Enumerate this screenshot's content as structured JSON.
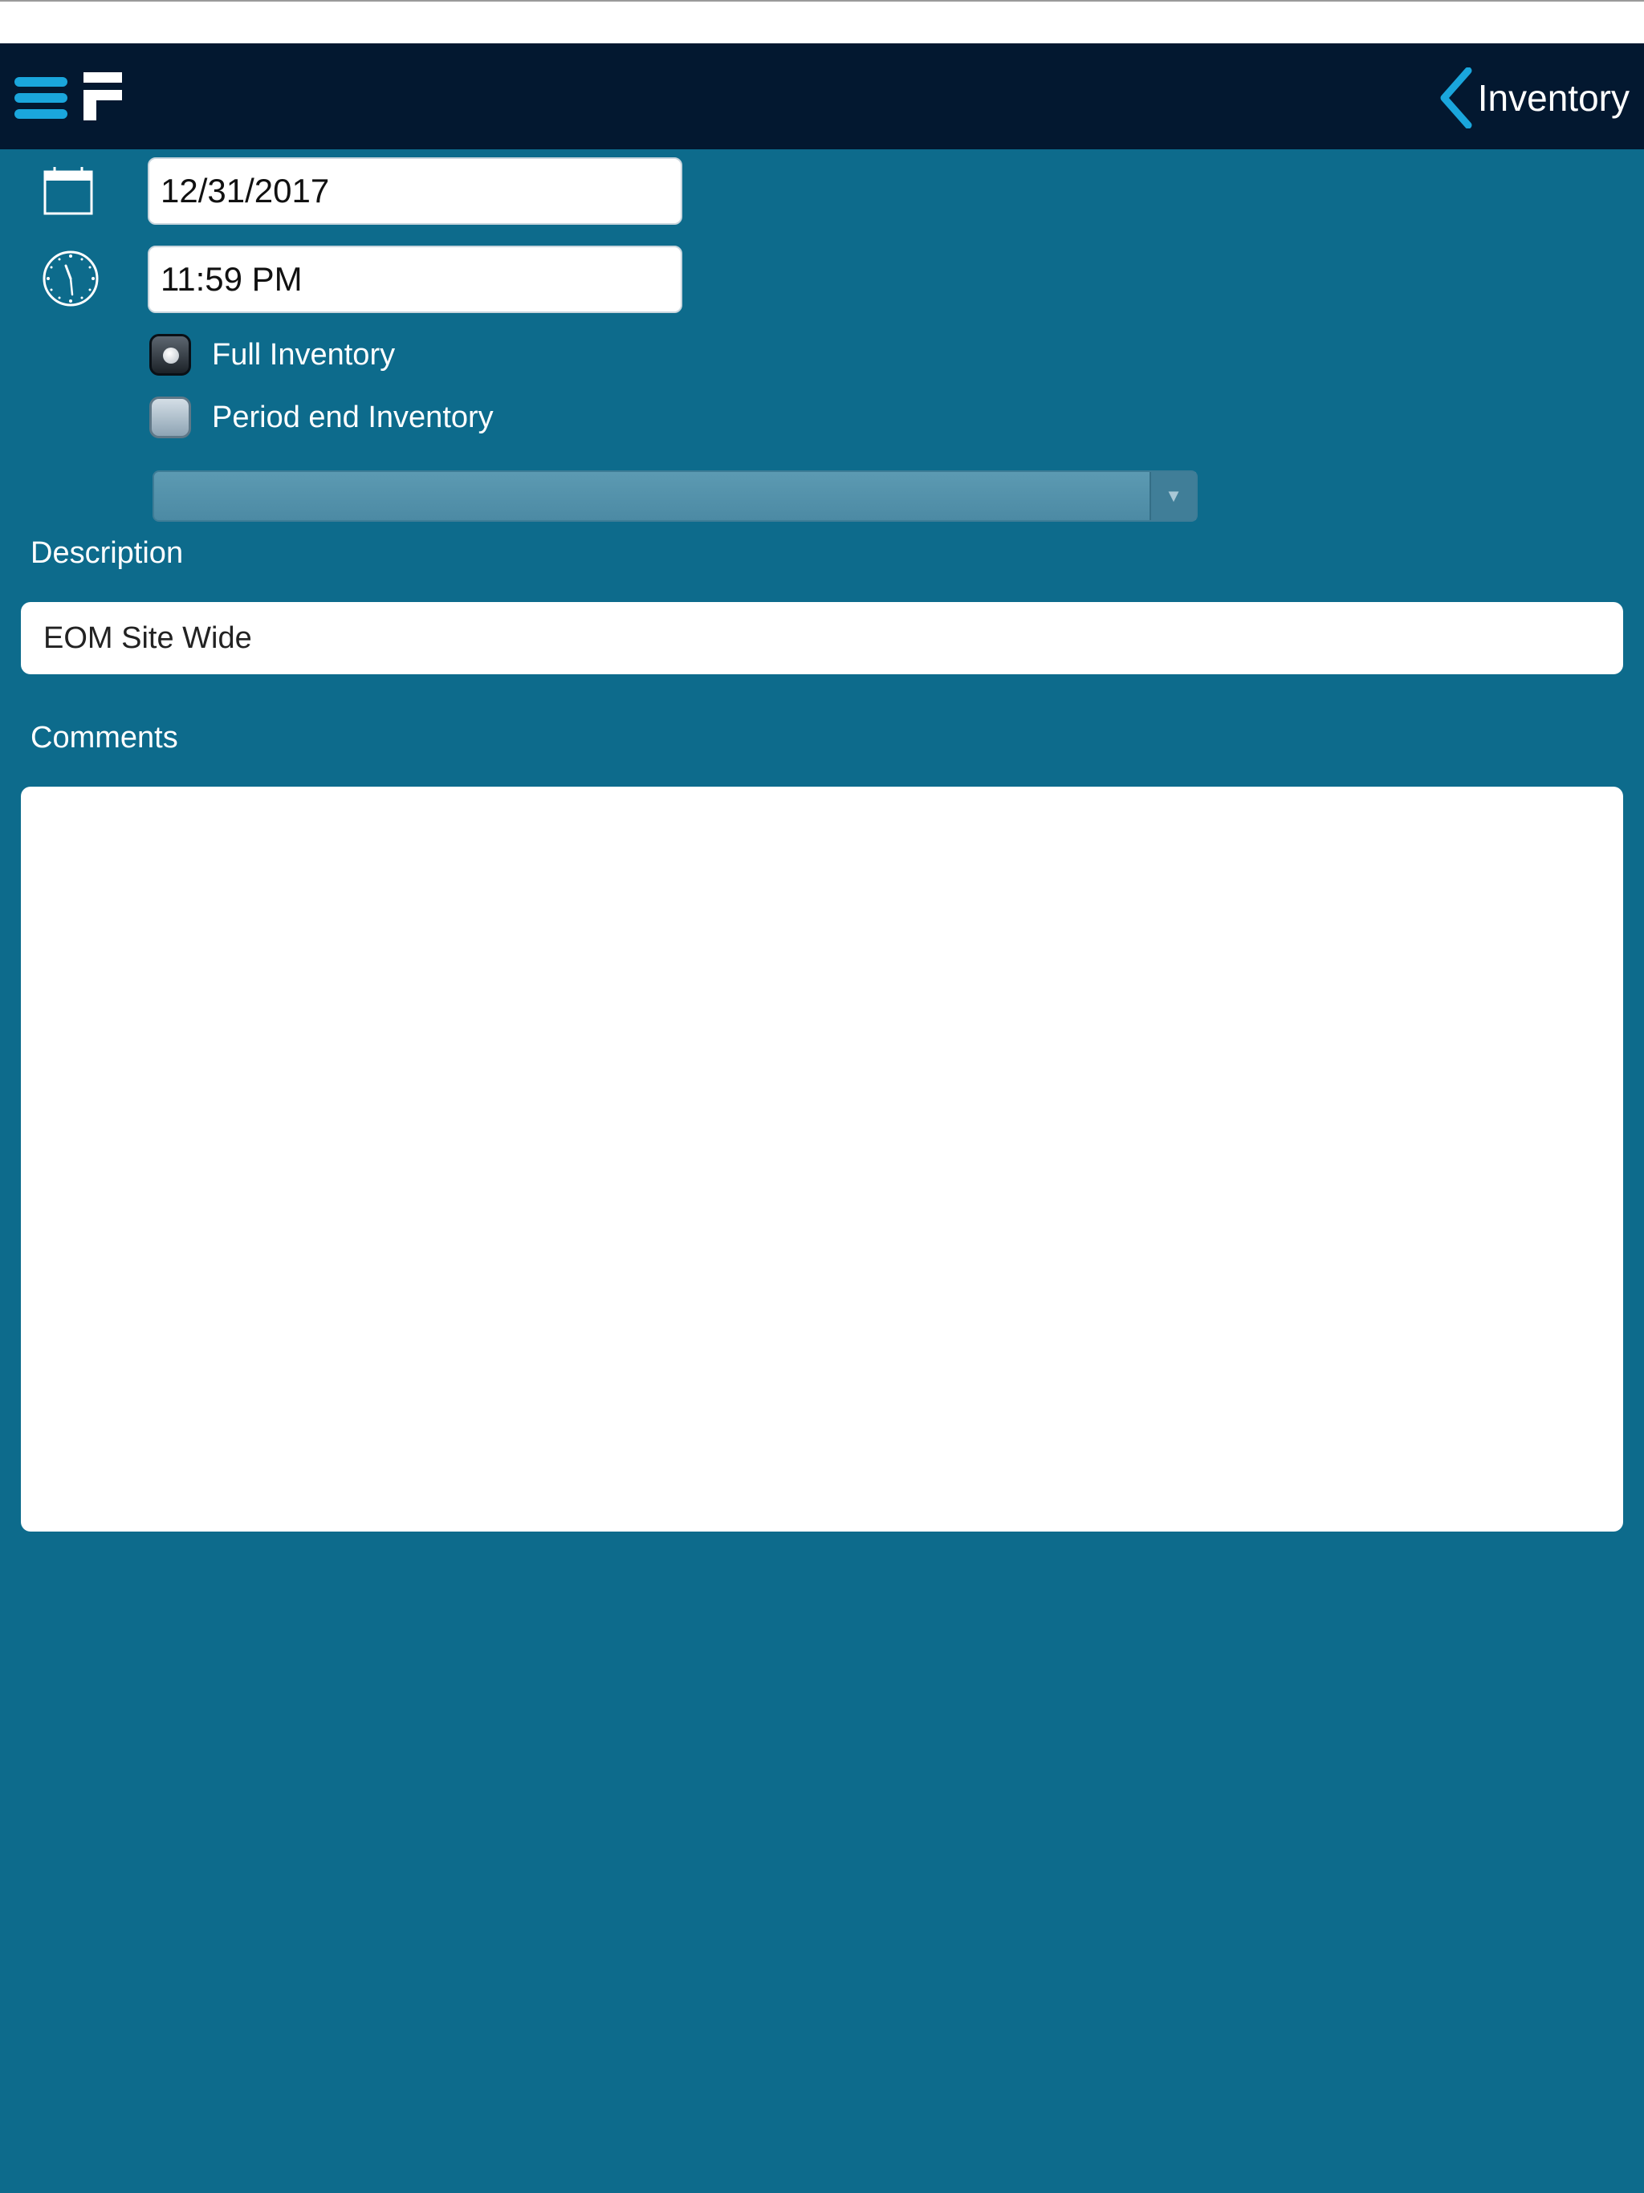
{
  "header": {
    "back_label": "Inventory"
  },
  "icons": {
    "menu": "hamburger-menu-icon",
    "logo": "f-logo-icon",
    "back": "chevron-left-icon",
    "date": "calendar-icon",
    "time": "clock-icon",
    "dropdown": "triangle-down-icon"
  },
  "colors": {
    "background": "#0d6b8c",
    "nav_bar": "#031830",
    "accent": "#1aa6dc"
  },
  "form": {
    "date_value": "12/31/2017",
    "time_value": "11:59 PM",
    "inventory_type": {
      "options": [
        "Full Inventory",
        "Period end Inventory"
      ],
      "selected": "Full Inventory"
    },
    "dropdown_value": "",
    "description_label": "Description",
    "description_value": "EOM Site Wide",
    "comments_label": "Comments",
    "comments_value": ""
  }
}
